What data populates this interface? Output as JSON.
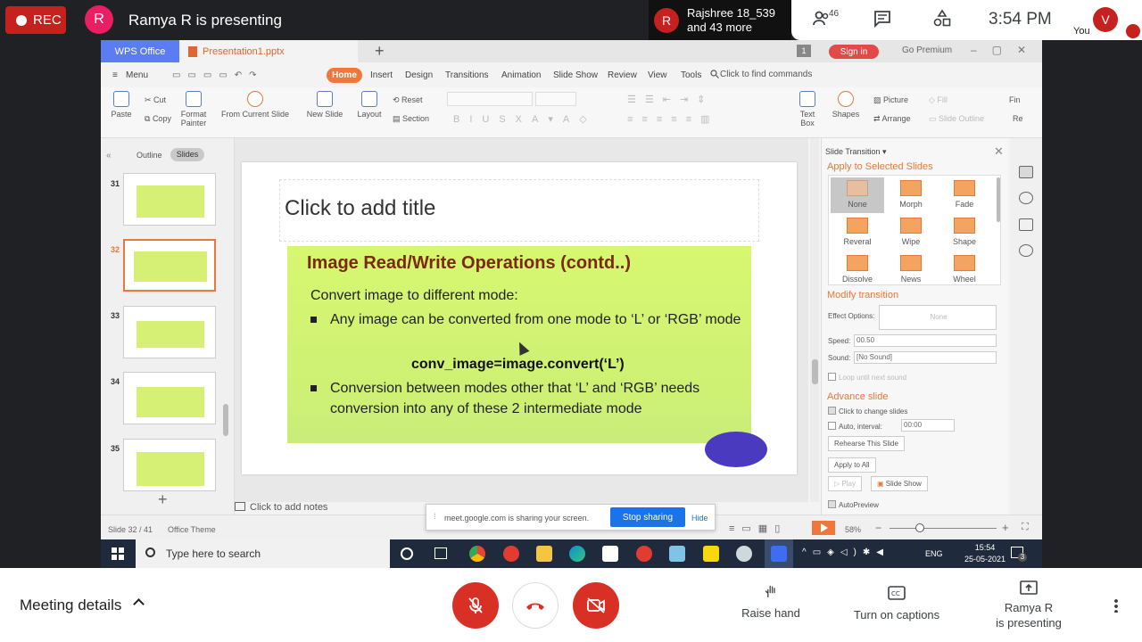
{
  "meet": {
    "rec_label": "REC",
    "presenter_initial": "R",
    "presenting_text": "Ramya R is presenting",
    "participants": {
      "initial": "R",
      "line1": "Rajshree 18_539",
      "line2": "and 43 more"
    },
    "people_count": "46",
    "clock": "3:54 PM",
    "self_initial": "V",
    "self_label": "You",
    "meeting_details": "Meeting details",
    "actions": {
      "raise_hand": "Raise hand",
      "captions": "Turn on captions",
      "presenting_line1": "Ramya R",
      "presenting_line2": "is presenting"
    },
    "colors": {
      "accent_red": "#d93025",
      "blue": "#1a73e8"
    }
  },
  "wps": {
    "app_tab": "WPS Office",
    "doc_tab": "Presentation1.pptx",
    "new_tab": "+",
    "tab_count": "1",
    "sign_in": "Sign in",
    "go_premium": "Go Premium",
    "menu": {
      "menu_label": "Menu",
      "tabs": [
        "Home",
        "Insert",
        "Design",
        "Transitions",
        "Animation",
        "Slide Show",
        "Review",
        "View",
        "Tools"
      ],
      "find": "Click to find commands"
    },
    "ribbon": {
      "paste": "Paste",
      "cut": "Cut",
      "copy": "Copy",
      "format_painter_1": "Format",
      "format_painter_2": "Painter",
      "from_current": "From Current Slide",
      "new_slide": "New Slide",
      "layout": "Layout",
      "reset": "Reset",
      "section": "Section",
      "text_box": "Text Box",
      "shapes": "Shapes",
      "picture": "Picture",
      "arrange": "Arrange",
      "fill": "Fill",
      "slide_outline": "Slide Outline",
      "find_short": "Fin",
      "re_short": "Re"
    },
    "left_panel": {
      "outline": "Outline",
      "slides": "Slides",
      "thumb_numbers": [
        "31",
        "32",
        "33",
        "34",
        "35"
      ],
      "add_slide": "+"
    },
    "slide": {
      "title_placeholder": "Click to add title",
      "content_title": "Image Read/Write Operations (contd..)",
      "content_sub": "Convert image to different mode:",
      "bullet1": "Any image can be converted from one mode to ‘L’ or ‘RGB’ mode",
      "code": "conv_image=image.convert(‘L’)",
      "bullet2": "Conversion between modes other that ‘L’ and ‘RGB’ needs conversion into any of these 2 intermediate mode"
    },
    "notes_placeholder": "Click to add notes",
    "right_panel": {
      "header": "Slide Transition",
      "apply_selected": "Apply to Selected Slides",
      "transitions": [
        "None",
        "Morph",
        "Fade",
        "Reveral",
        "Wipe",
        "Shape",
        "Dissolve",
        "News",
        "Wheel"
      ],
      "modify": "Modify transition",
      "effect_options": "Effect Options:",
      "effect_value": "None",
      "speed": "Speed:",
      "speed_value": "00.50",
      "sound": "Sound:",
      "sound_value": "[No Sound]",
      "loop": "Loop until next sound",
      "advance": "Advance slide",
      "on_click": "Click to change slides",
      "auto_interval": "Auto, interval:",
      "interval_value": "00:00",
      "rehearse": "Rehearse This Slide",
      "apply_all": "Apply to All",
      "play": "Play",
      "slide_show": "Slide Show",
      "autopreview": "AutoPreview"
    },
    "status": {
      "slide_info": "Slide 32 / 41",
      "theme": "Office Theme",
      "zoom": "58%"
    },
    "share_bar": {
      "text": "meet.google.com is sharing your screen.",
      "stop": "Stop sharing",
      "hide": "Hide"
    },
    "taskbar": {
      "search_placeholder": "Type here to search",
      "lang": "ENG",
      "time": "15:54",
      "date": "25-05-2021",
      "notif_count": "3"
    }
  }
}
